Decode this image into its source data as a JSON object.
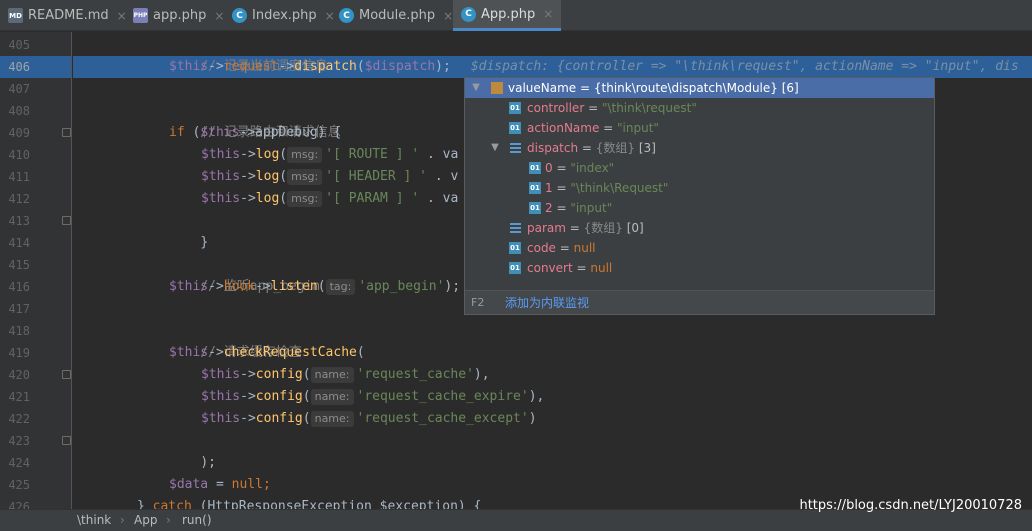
{
  "tabs": [
    {
      "label": "README.md",
      "icon": "markdown-file-icon",
      "icon_text": "MD"
    },
    {
      "label": "app.php",
      "icon": "php-file-icon",
      "icon_text": "PHP"
    },
    {
      "label": "Index.php",
      "icon": "php-class-icon",
      "icon_text": "C"
    },
    {
      "label": "Module.php",
      "icon": "php-class-icon",
      "icon_text": "C"
    },
    {
      "label": "App.php",
      "icon": "php-class-icon",
      "icon_text": "C",
      "active": true
    }
  ],
  "close_glyph": "×",
  "line_numbers": [
    "405",
    "406",
    "407",
    "408",
    "409",
    "410",
    "411",
    "412",
    "413",
    "414",
    "415",
    "416",
    "417",
    "418",
    "419",
    "420",
    "421",
    "422",
    "423",
    "424",
    "425",
    "426"
  ],
  "current_line": "406",
  "code": {
    "l405": {
      "comment": "// 记录当前调度信息"
    },
    "l406": {
      "var": "$this",
      "arrow1": "->",
      "prop": "request",
      "arrow2": "->",
      "fn": "dispatch",
      "open": "(",
      "arg": "$dispatch",
      "close": ");",
      "inline": "$dispatch: {controller => \"\\think\\request\", actionName => \"input\", dis"
    },
    "l408": {
      "comment": "// 记录路由和请求信息"
    },
    "l409": {
      "kw": "if",
      "open": " (",
      "var": "$this",
      "arrow": "->",
      "prop": "appDebug",
      "close": ") {"
    },
    "l410": {
      "var": "$this",
      "arrow": "->",
      "fn": "log",
      "open": "(",
      "hint": "msg:",
      "str": "'[ ROUTE ] '",
      "rest": " . va"
    },
    "l411": {
      "var": "$this",
      "arrow": "->",
      "fn": "log",
      "open": "(",
      "hint": "msg:",
      "str": "'[ HEADER ] '",
      "rest": " . v"
    },
    "l412": {
      "var": "$this",
      "arrow": "->",
      "fn": "log",
      "open": "(",
      "hint": "msg:",
      "str": "'[ PARAM ] '",
      "rest": " . va"
    },
    "l413": {
      "text": "}"
    },
    "l415": {
      "comment": "// 监听app_begin"
    },
    "l416": {
      "var": "$this",
      "arrow1": "->",
      "prop": "hook",
      "arrow2": "->",
      "fn": "listen",
      "open": "(",
      "hint": "tag:",
      "str": "'app_begin'",
      "close": ");"
    },
    "l418": {
      "comment": "// 请求缓存检查"
    },
    "l419": {
      "var": "$this",
      "arrow": "->",
      "fn": "checkRequestCache",
      "open": "("
    },
    "l420": {
      "var": "$this",
      "arrow": "->",
      "fn": "config",
      "open": "(",
      "hint": "name:",
      "str": "'request_cache'",
      "close": "),"
    },
    "l421": {
      "var": "$this",
      "arrow": "->",
      "fn": "config",
      "open": "(",
      "hint": "name:",
      "str": "'request_cache_expire'",
      "close": "),"
    },
    "l422": {
      "var": "$this",
      "arrow": "->",
      "fn": "config",
      "open": "(",
      "hint": "name:",
      "str": "'request_cache_except'",
      "close": ")"
    },
    "l423": {
      "text": ");"
    },
    "l425": {
      "var": "$data",
      "eq": " = ",
      "kw": "null",
      "semi": ";"
    },
    "l426": {
      "close": "} ",
      "kw": "catch",
      "rest": " (HttpResponseException $exception) {"
    }
  },
  "popup": {
    "root": {
      "chevron": "▼",
      "name": "valueName",
      "eq": " = ",
      "value": "{think\\route\\dispatch\\Module} [6]"
    },
    "fields": [
      {
        "name": "controller",
        "eq": " = ",
        "value": "\"\\think\\request\"",
        "kind": "str"
      },
      {
        "name": "actionName",
        "eq": " = ",
        "value": "\"input\"",
        "kind": "str"
      }
    ],
    "dispatch": {
      "chevron": "▼",
      "name": "dispatch",
      "eq": " = ",
      "type": "{数组}",
      "count": " [3]"
    },
    "dispatch_items": [
      {
        "name": "0",
        "eq": " = ",
        "value": "\"index\""
      },
      {
        "name": "1",
        "eq": " = ",
        "value": "\"\\think\\Request\""
      },
      {
        "name": "2",
        "eq": " = ",
        "value": "\"input\""
      }
    ],
    "param": {
      "name": "param",
      "eq": " = ",
      "type": "{数组}",
      "count": " [0]"
    },
    "tail": [
      {
        "name": "code",
        "eq": " = ",
        "value": "null"
      },
      {
        "name": "convert",
        "eq": " = ",
        "value": "null"
      }
    ],
    "field_icon_text": "01",
    "footer_key": "F2",
    "footer_action": "添加为内联监视"
  },
  "breadcrumb": [
    "\\think",
    "App",
    "run()"
  ],
  "breadcrumb_sep": "›",
  "watermark": "https://blog.csdn.net/LYJ20010728"
}
